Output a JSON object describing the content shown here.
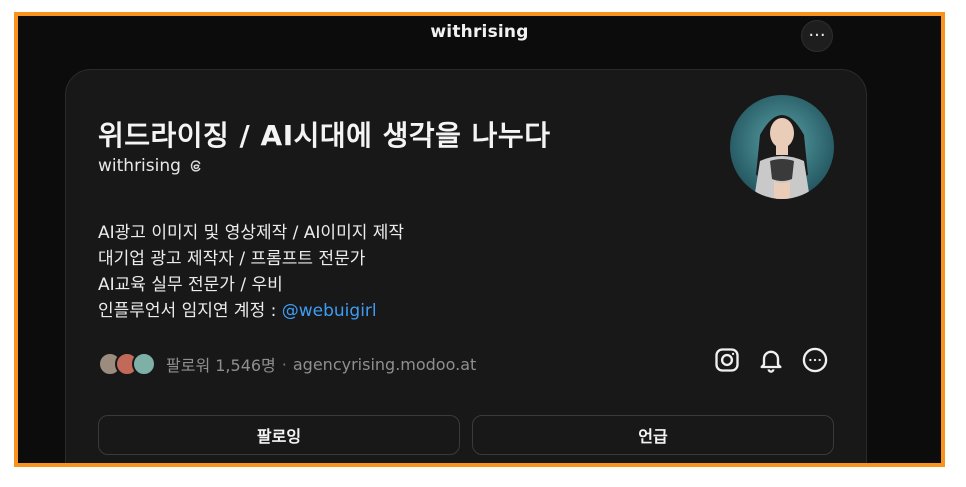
{
  "header": {
    "title": "withrising",
    "more_label": "···"
  },
  "profile": {
    "display_name": "위드라이징 / AI시대에 생각을 나누다",
    "username": "withrising",
    "username_icon": "threads-icon",
    "avatar": "profile-photo"
  },
  "bio": {
    "line1": "AI광고 이미지 및 영상제작 / AI이미지 제작",
    "line2": "대기업 광고 제작자 / 프롬프트 전문가",
    "line3": "AI교육 실무 전문가 / 우비",
    "line4_text": "인플루언서 임지연 계정 : ",
    "line4_mention": "@webuigirl"
  },
  "stats": {
    "followers": "팔로워 1,546명",
    "separator": "·",
    "link": "agencyrising.modoo.at"
  },
  "actions": {
    "icons": [
      "instagram-icon",
      "bell-icon",
      "more-icon"
    ]
  },
  "buttons": {
    "follow": "팔로잉",
    "mention": "언급"
  },
  "colors": {
    "accent_frame": "#f7931e",
    "background": "#0c0c0c",
    "card": "#181818",
    "link": "#3f9cf4"
  }
}
